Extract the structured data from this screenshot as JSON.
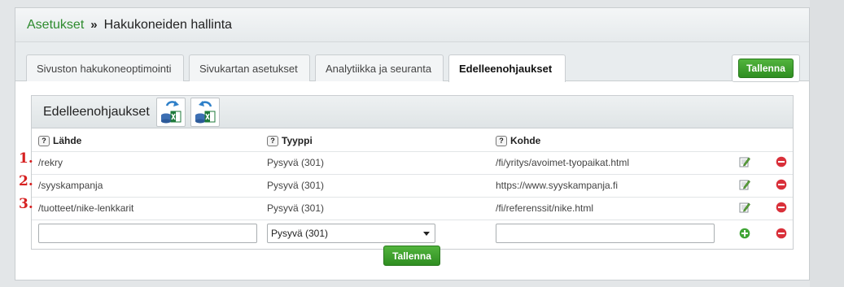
{
  "breadcrumb": {
    "parent": "Asetukset",
    "separator": "»",
    "current": "Hakukoneiden hallinta"
  },
  "tabs": [
    {
      "label": "Sivuston hakukoneoptimointi",
      "active": false
    },
    {
      "label": "Sivukartan asetukset",
      "active": false
    },
    {
      "label": "Analytiikka ja seuranta",
      "active": false
    },
    {
      "label": "Edelleenohjaukset",
      "active": true
    }
  ],
  "save_label": "Tallenna",
  "redirects": {
    "title": "Edelleenohjaukset",
    "help_glyph": "?",
    "columns": {
      "source": "Lähde",
      "type": "Tyyppi",
      "target": "Kohde"
    },
    "rows": [
      {
        "marker": "1.",
        "source": "/rekry",
        "type": "Pysyvä (301)",
        "target": "/fi/yritys/avoimet-tyopaikat.html"
      },
      {
        "marker": "2.",
        "source": "/syyskampanja",
        "type": "Pysyvä (301)",
        "target": "https://www.syyskampanja.fi"
      },
      {
        "marker": "3.",
        "source": "/tuotteet/nike-lenkkarit",
        "type": "Pysyvä (301)",
        "target": "/fi/referenssit/nike.html"
      }
    ],
    "new_row": {
      "source_value": "",
      "type_selected": "Pysyvä (301)",
      "target_value": ""
    }
  },
  "colors": {
    "accent_green": "#2e8b2e",
    "button_green": "#3d9f2c",
    "marker_red": "#d62020",
    "delete_red": "#d9303a"
  },
  "icons": {
    "edit": "edit-pencil-icon",
    "delete": "delete-icon",
    "add": "add-icon",
    "import": "import-excel-icon",
    "export": "export-excel-icon"
  }
}
